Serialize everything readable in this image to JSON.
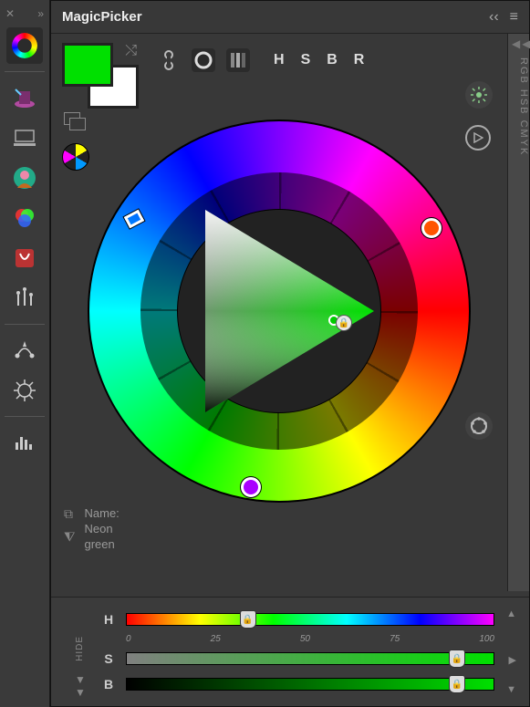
{
  "panel_title": "MagicPicker",
  "side_label": "RGB HSB CMYK",
  "mode_letters": [
    "H",
    "S",
    "B",
    "R"
  ],
  "color_name_label": "Name:",
  "color_name_line1": "Neon",
  "color_name_line2": "green",
  "fg_color": "#00e000",
  "bg_color": "#ffffff",
  "sliders": {
    "hide_label": "HIDE",
    "h_label": "H",
    "s_label": "S",
    "b_label": "B",
    "scale": [
      "0",
      "25",
      "50",
      "75",
      "100"
    ],
    "h_value_pct": 33,
    "s_value_pct": 90,
    "b_value_pct": 90
  },
  "wheel": {
    "hue_marker_deg": 120,
    "complement1_deg": 20,
    "complement2_deg": 260
  }
}
